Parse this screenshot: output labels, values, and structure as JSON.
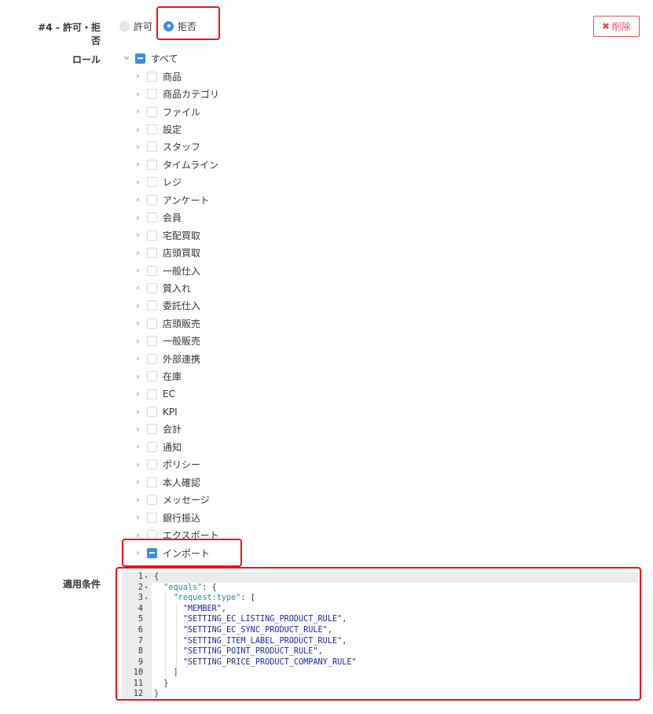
{
  "rule": {
    "label": "#4 - 許可・拒否",
    "options": [
      {
        "label": "許可",
        "selected": false
      },
      {
        "label": "拒否",
        "selected": true
      }
    ],
    "delete_label": "削除",
    "delete_icon": "✖"
  },
  "role": {
    "label": "ロール",
    "root_label": "すべて",
    "items": [
      {
        "label": "商品",
        "checked": "none"
      },
      {
        "label": "商品カテゴリ",
        "checked": "none"
      },
      {
        "label": "ファイル",
        "checked": "none"
      },
      {
        "label": "設定",
        "checked": "none"
      },
      {
        "label": "スタッフ",
        "checked": "none"
      },
      {
        "label": "タイムライン",
        "checked": "none"
      },
      {
        "label": "レジ",
        "checked": "none"
      },
      {
        "label": "アンケート",
        "checked": "none"
      },
      {
        "label": "会員",
        "checked": "none"
      },
      {
        "label": "宅配買取",
        "checked": "none"
      },
      {
        "label": "店頭買取",
        "checked": "none"
      },
      {
        "label": "一般仕入",
        "checked": "none"
      },
      {
        "label": "質入れ",
        "checked": "none"
      },
      {
        "label": "委託仕入",
        "checked": "none"
      },
      {
        "label": "店頭販売",
        "checked": "none"
      },
      {
        "label": "一般販売",
        "checked": "none"
      },
      {
        "label": "外部連携",
        "checked": "none"
      },
      {
        "label": "在庫",
        "checked": "none"
      },
      {
        "label": "EC",
        "checked": "none"
      },
      {
        "label": "KPI",
        "checked": "none"
      },
      {
        "label": "会計",
        "checked": "none"
      },
      {
        "label": "通知",
        "checked": "none"
      },
      {
        "label": "ポリシー",
        "checked": "none"
      },
      {
        "label": "本人確認",
        "checked": "none"
      },
      {
        "label": "メッセージ",
        "checked": "none"
      },
      {
        "label": "銀行振込",
        "checked": "none"
      },
      {
        "label": "エクスポート",
        "checked": "none"
      },
      {
        "label": "インポート",
        "checked": "indeterminate"
      }
    ]
  },
  "conditions": {
    "label": "適用条件",
    "lines": [
      {
        "n": "1",
        "fold": true,
        "tokens": [
          {
            "t": "p",
            "v": "{"
          }
        ]
      },
      {
        "n": "2",
        "fold": true,
        "tokens": [
          {
            "t": "p",
            "v": "  "
          },
          {
            "t": "k",
            "v": "\"equals\""
          },
          {
            "t": "p",
            "v": ": {"
          }
        ]
      },
      {
        "n": "3",
        "fold": true,
        "tokens": [
          {
            "t": "p",
            "v": "    "
          },
          {
            "t": "k",
            "v": "\"request:type\""
          },
          {
            "t": "p",
            "v": ": ["
          }
        ]
      },
      {
        "n": "4",
        "fold": false,
        "tokens": [
          {
            "t": "p",
            "v": "      "
          },
          {
            "t": "s",
            "v": "\"MEMBER\""
          },
          {
            "t": "p",
            "v": ","
          }
        ]
      },
      {
        "n": "5",
        "fold": false,
        "tokens": [
          {
            "t": "p",
            "v": "      "
          },
          {
            "t": "s",
            "v": "\"SETTING_EC_LISTING_PRODUCT_RULE\""
          },
          {
            "t": "p",
            "v": ","
          }
        ]
      },
      {
        "n": "6",
        "fold": false,
        "tokens": [
          {
            "t": "p",
            "v": "      "
          },
          {
            "t": "s",
            "v": "\"SETTING_EC_SYNC_PRODUCT_RULE\""
          },
          {
            "t": "p",
            "v": ","
          }
        ]
      },
      {
        "n": "7",
        "fold": false,
        "tokens": [
          {
            "t": "p",
            "v": "      "
          },
          {
            "t": "s",
            "v": "\"SETTING_ITEM_LABEL_PRODUCT_RULE\""
          },
          {
            "t": "p",
            "v": ","
          }
        ]
      },
      {
        "n": "8",
        "fold": false,
        "tokens": [
          {
            "t": "p",
            "v": "      "
          },
          {
            "t": "s",
            "v": "\"SETTING_POINT_PRODUCT_RULE\""
          },
          {
            "t": "p",
            "v": ","
          }
        ]
      },
      {
        "n": "9",
        "fold": false,
        "tokens": [
          {
            "t": "p",
            "v": "      "
          },
          {
            "t": "s",
            "v": "\"SETTING_PRICE_PRODUCT_COMPANY_RULE\""
          }
        ]
      },
      {
        "n": "10",
        "fold": false,
        "tokens": [
          {
            "t": "p",
            "v": "    ]"
          }
        ]
      },
      {
        "n": "11",
        "fold": false,
        "tokens": [
          {
            "t": "p",
            "v": "  }"
          }
        ]
      },
      {
        "n": "12",
        "fold": false,
        "tokens": [
          {
            "t": "p",
            "v": "}"
          }
        ]
      }
    ]
  }
}
